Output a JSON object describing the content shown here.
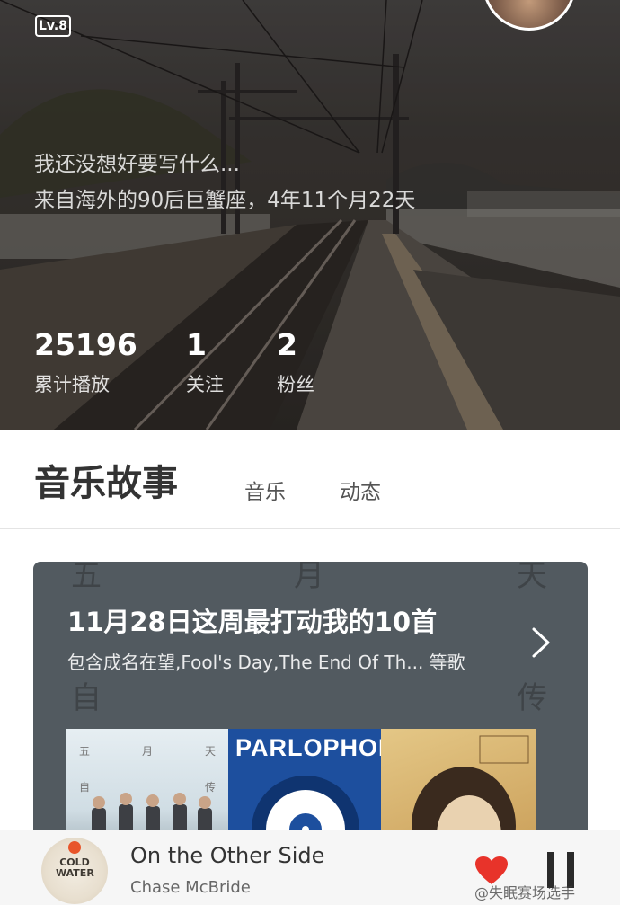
{
  "profile": {
    "level_badge": "Lv.8",
    "bio_line_1": "我还没想好要写什么...",
    "bio_line_2": "来自海外的90后巨蟹座，4年11个月22天",
    "stats": [
      {
        "value": "25196",
        "label": "累计播放"
      },
      {
        "value": "1",
        "label": "关注"
      },
      {
        "value": "2",
        "label": "粉丝"
      }
    ]
  },
  "tabs": {
    "active": "音乐故事",
    "items": [
      "音乐",
      "动态"
    ]
  },
  "playlist_card": {
    "title": "11月28日这周最打动我的10首",
    "subtitle": "包含成名在望,Fool's Day,The End Of Th... 等歌",
    "background_chars": [
      "五",
      "月",
      "天",
      "自",
      "传"
    ],
    "covers": [
      {
        "title_chars": [
          "五",
          "月",
          "天",
          "自",
          "传"
        ],
        "color": "#dde7ec"
      },
      {
        "brand": "PARLOPHONE",
        "color": "#1d4f9e"
      },
      {
        "color": "#d8b36e"
      }
    ]
  },
  "player": {
    "song_title": "On the Other Side",
    "artist": "Chase McBride",
    "disc_text": "COLD WATER",
    "liked": true,
    "state": "playing",
    "accent": "#e8332a"
  },
  "watermark": "@失眠赛场选手",
  "icons": {
    "arrow": "chevron-right-icon",
    "heart": "heart-icon",
    "pause": "pause-icon"
  }
}
